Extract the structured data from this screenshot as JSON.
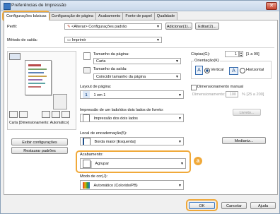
{
  "window": {
    "title": "Preferências de Impressão",
    "close_glyph": "✕"
  },
  "tabs": [
    {
      "label": "Configurações básicas",
      "active": true
    },
    {
      "label": "Configuração de página",
      "active": false
    },
    {
      "label": "Acabamento",
      "active": false
    },
    {
      "label": "Fonte de papel",
      "active": false
    },
    {
      "label": "Qualidade",
      "active": false
    }
  ],
  "profile": {
    "label": "Perfil:",
    "value": "<Alterar> Configurações padrão",
    "add_button": "Adicionar(1)...",
    "edit_button": "Editar(2)..."
  },
  "output_method": {
    "label": "Método de saída:",
    "value": "Imprimir"
  },
  "preview": {
    "caption": "Carta [Dimensionamento: Automático]"
  },
  "left_buttons": {
    "apply": "Exibir configurações",
    "restore": "Restaurar padrões"
  },
  "page_size": {
    "label": "Tamanho da página:",
    "value": "Carta"
  },
  "output_size": {
    "label": "Tamanho da saída:",
    "value": "Coincidir tamanho da página"
  },
  "layout": {
    "label": "Layout de página:",
    "value": "1 em 1",
    "number": "1"
  },
  "duplex": {
    "label": "Impressão de um lado/dos dois lados de livreto:",
    "value": "Impressão dos dois lados"
  },
  "binding": {
    "label": "Local de encadernação(5):",
    "value": "Borda maior [Esquerda]",
    "margin_button": "Medianiz..."
  },
  "finishing": {
    "label": "Acabamento:",
    "value": "Agrupar",
    "badge": "a"
  },
  "color_mode": {
    "label": "Modo de cor(J):",
    "value": "Automático (Colorido/PB)"
  },
  "copies": {
    "label": "Cópias(G):",
    "value": "1",
    "range": "[1 a 99]"
  },
  "orientation": {
    "label": "Orientação(K)",
    "vertical": "Vertical",
    "horizontal": "Horizontal",
    "glyph": "A"
  },
  "manual_scaling": {
    "label": "Dimensionamento manual",
    "field_label": "Dimensionamento:",
    "value": "100",
    "range": "% [25 a 200]"
  },
  "booklet_button": "Livreto...",
  "footer": {
    "ok": "OK",
    "cancel": "Cancelar",
    "help": "Ajuda"
  },
  "colors": {
    "accent": "#f0a93a"
  }
}
